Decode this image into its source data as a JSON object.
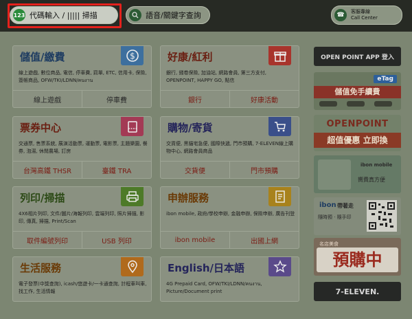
{
  "topbar": {
    "code_button": {
      "badge": "123",
      "label": "代碼輸入 / ||||| 掃描"
    },
    "voice_button": {
      "label": "語音/關鍵字查詢"
    },
    "call_button": {
      "line1": "客服專線",
      "line2": "Call Center"
    }
  },
  "cards": [
    {
      "title": "儲值/繳費",
      "icon": "dollar-icon",
      "desc": "線上遊戲, 數位商品, 電信, 停車費, 罰單, ETC, 信用卡, 保險, 簽帳商品, OFW/TKI/LDNN/คนงาน",
      "actions": [
        "線上遊戲",
        "停車費"
      ],
      "accent": "#3d6f9e"
    },
    {
      "title": "好康/紅利",
      "icon": "gift-icon",
      "desc": "銀行, 錢卷保險, 加油站, 網路會員, 第三方支付, OPENPOINT, HAPPY GO, 點信",
      "actions": [
        "銀行",
        "好康活動"
      ],
      "accent": "#a8342c"
    },
    {
      "title": "票券中心",
      "icon": "ticket-icon",
      "desc": "交通票, 售票系統, 展演活動票, 運動票, 電影票, 主題樂園, 餐券, 泡湯, 休閒農場, 訂房",
      "actions": [
        "台灣高鐵 THSR",
        "臺鐵 TRA"
      ],
      "accent": "#a33a55"
    },
    {
      "title": "購物/寄貨",
      "icon": "cart-icon",
      "desc": "交貨便, 黑貓宅急便, 國際快遞, 門市預購, 7-ELEVEN線上購物中心, 網路會員商品",
      "actions": [
        "交貨便",
        "門市預購"
      ],
      "accent": "#3a4f8a"
    },
    {
      "title": "列印/掃描",
      "icon": "printer-icon",
      "desc": "4X6相片列印, 文件/圖片/海報列印, 雲端列印, 照片掃描, 影印, 傳真, 掃描, Print/Scan",
      "actions": [
        "取件編號列印",
        "USB 列印"
      ],
      "accent": "#4d7a28"
    },
    {
      "title": "申辦服務",
      "icon": "document-icon",
      "desc": "ibon mobile, 政府/學校申辦, 金融申辦, 保險申辦, 廣告刊登",
      "actions": [
        "ibon mobile",
        "出國上網"
      ],
      "accent": "#a8821c"
    },
    {
      "title": "生活服務",
      "icon": "location-pin-icon",
      "desc": "電子發票(中獎查詢), icash/悠遊卡/一卡通查詢, 計程車叫車, 找工作, 生活情報",
      "actions": [],
      "accent": "#b06a1c"
    },
    {
      "title": "English/日本語",
      "icon": "star-icon",
      "desc": "4G Prepaid Card, OFW/TKI/LDNN/คนงาน, Picture/Document print",
      "actions": [],
      "accent": "#5a4a8a"
    }
  ],
  "side": {
    "openpoint_login": "OPEN POINT APP 登入",
    "etag": {
      "logo": "eTag",
      "text": "儲值免手續費"
    },
    "openpoint_promo": {
      "logo": "OPENPOINT",
      "text": "超值優惠 立即換"
    },
    "ibon_app": {
      "logo": "ibon mobile",
      "text": "嚮費真方便"
    },
    "qr_promo": {
      "logo": "ibon",
      "line1": "帶著走",
      "line2": "隨時預 · 隨手印"
    },
    "preorder": {
      "small": "名店美食",
      "big": "預購中"
    },
    "seven_eleven": "7-ELEVEN."
  }
}
